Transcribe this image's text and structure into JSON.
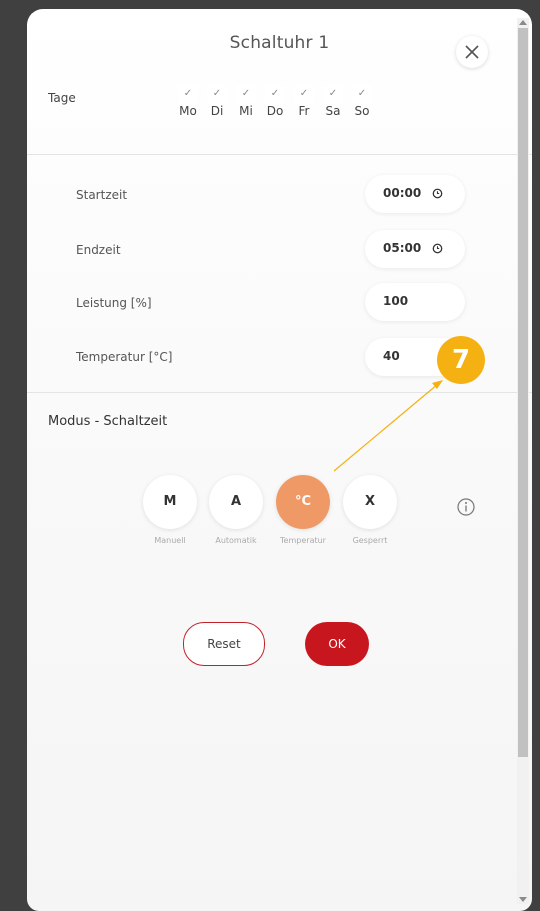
{
  "dialog": {
    "title": "Schaltuhr 1"
  },
  "tage": {
    "label": "Tage",
    "check_glyph": "✓",
    "days": [
      {
        "label": "Mo",
        "checked": true
      },
      {
        "label": "Di",
        "checked": true
      },
      {
        "label": "Mi",
        "checked": true
      },
      {
        "label": "Do",
        "checked": true
      },
      {
        "label": "Fr",
        "checked": true
      },
      {
        "label": "Sa",
        "checked": true
      },
      {
        "label": "So",
        "checked": true
      }
    ]
  },
  "fields": {
    "startzeit": {
      "label": "Startzeit",
      "value": "00:00",
      "icon": "clock-icon"
    },
    "endzeit": {
      "label": "Endzeit",
      "value": "05:00",
      "icon": "clock-icon"
    },
    "leistung": {
      "label": "Leistung [%]",
      "value": "100"
    },
    "temperatur": {
      "label": "Temperatur [°C]",
      "value": "40"
    }
  },
  "modus": {
    "label": "Modus - Schaltzeit",
    "options": [
      {
        "key": "M",
        "caption": "Manuell",
        "active": false
      },
      {
        "key": "A",
        "caption": "Automatik",
        "active": false
      },
      {
        "key": "°C",
        "caption": "Temperatur",
        "active": true
      },
      {
        "key": "X",
        "caption": "Gesperrt",
        "active": false
      }
    ]
  },
  "buttons": {
    "reset": "Reset",
    "ok": "OK"
  },
  "annotation": {
    "badge": "7"
  },
  "colors": {
    "accent_orange": "#ef9a66",
    "ok_red": "#c8161f",
    "badge_yellow": "#f5b111"
  }
}
